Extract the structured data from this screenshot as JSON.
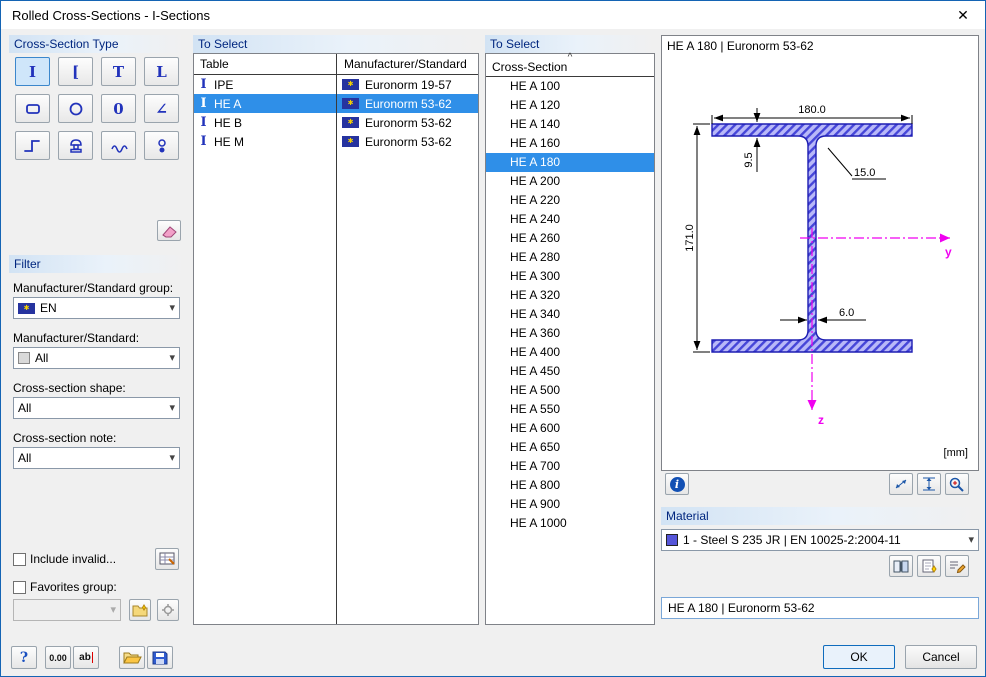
{
  "window": {
    "title": "Rolled Cross-Sections - I-Sections",
    "close_glyph": "✕"
  },
  "ui": {
    "dropdown_glyph": "▾",
    "sort_glyph": "^",
    "ibeam_glyph": "I",
    "info_glyph": "i",
    "flag_glyph": "✱"
  },
  "type_panel": {
    "header": "Cross-Section Type",
    "glyphs": [
      "I",
      "[",
      "T",
      "L",
      "",
      "",
      "0",
      "∠",
      "",
      "",
      "",
      ""
    ]
  },
  "filter": {
    "header": "Filter",
    "std_group_label": "Manufacturer/Standard group:",
    "std_group_value": "EN",
    "std_label": "Manufacturer/Standard:",
    "std_value": "All",
    "shape_label": "Cross-section shape:",
    "shape_value": "All",
    "note_label": "Cross-section note:",
    "note_value": "All",
    "include_invalid_label": "Include invalid...",
    "favorites_label": "Favorites group:"
  },
  "table_panel": {
    "header": "To Select",
    "columns": [
      "Table",
      "Manufacturer/Standard"
    ],
    "rows": [
      {
        "table": "IPE",
        "standard": "Euronorm 19-57",
        "selected": false
      },
      {
        "table": "HE A",
        "standard": "Euronorm 53-62",
        "selected": true
      },
      {
        "table": "HE B",
        "standard": "Euronorm 53-62",
        "selected": false
      },
      {
        "table": "HE M",
        "standard": "Euronorm 53-62",
        "selected": false
      }
    ]
  },
  "list_panel": {
    "header": "To Select",
    "column": "Cross-Section",
    "selected": "HE A 180",
    "items": [
      "HE A 100",
      "HE A 120",
      "HE A 140",
      "HE A 160",
      "HE A 180",
      "HE A 200",
      "HE A 220",
      "HE A 240",
      "HE A 260",
      "HE A 280",
      "HE A 300",
      "HE A 320",
      "HE A 340",
      "HE A 360",
      "HE A 400",
      "HE A 450",
      "HE A 500",
      "HE A 550",
      "HE A 600",
      "HE A 650",
      "HE A 700",
      "HE A 800",
      "HE A 900",
      "HE A 1000"
    ]
  },
  "preview": {
    "title": "HE A 180 | Euronorm 53-62",
    "units_label": "[mm]",
    "dim_width": "180.0",
    "dim_height": "171.0",
    "dim_flange": "9.5",
    "dim_radius": "15.0",
    "dim_web": "6.0",
    "axis_y": "y",
    "axis_z": "z"
  },
  "material": {
    "header": "Material",
    "value": "1 - Steel S 235 JR | EN 10025-2:2004-11"
  },
  "description_value": "HE A 180 | Euronorm 53-62",
  "footer": {
    "help_glyph": "?",
    "units_label": "0.00",
    "comment_label": "ab",
    "ok_label": "OK",
    "cancel_label": "Cancel"
  },
  "colors": {
    "selection": "#2f8fe8",
    "icon_blue": "#2233bb",
    "axis_magenta": "#f000f0",
    "section_fill": "#b8b8f8",
    "section_hatch": "#4646d8",
    "section_stroke": "#1d1db2"
  }
}
